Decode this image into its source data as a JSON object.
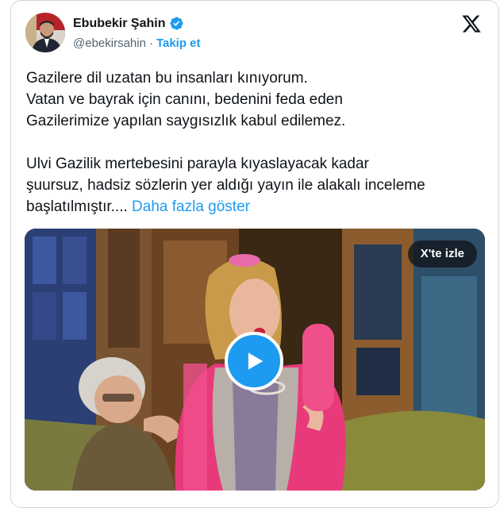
{
  "author": {
    "name": "Ebubekir Şahin",
    "handle": "@ebekirsahin",
    "separator": "·",
    "follow_label": "Takip et",
    "verified": true
  },
  "tweet": {
    "paragraph1": [
      "Gazilere dil uzatan bu insanları kınıyorum.",
      "Vatan ve bayrak için canını, bedenini feda eden",
      "Gazilerimize yapılan saygısızlık kabul edilemez."
    ],
    "paragraph2": [
      "Ulvi Gazilik mertebesini parayla kıyaslayacak kadar",
      "şuursuz, hadsiz sözlerin yer aldığı yayın ile alakalı inceleme",
      "başlatılmıştır...."
    ],
    "show_more_label": "Daha fazla göster"
  },
  "media": {
    "watch_on_x_label": "X'te izle",
    "type": "video"
  },
  "icons": {
    "platform": "x-logo-icon",
    "verified": "verified-badge-icon",
    "play": "play-icon"
  },
  "colors": {
    "accent": "#1d9bf0",
    "text": "#0f1419",
    "muted": "#536471",
    "border": "#cfd9de"
  }
}
